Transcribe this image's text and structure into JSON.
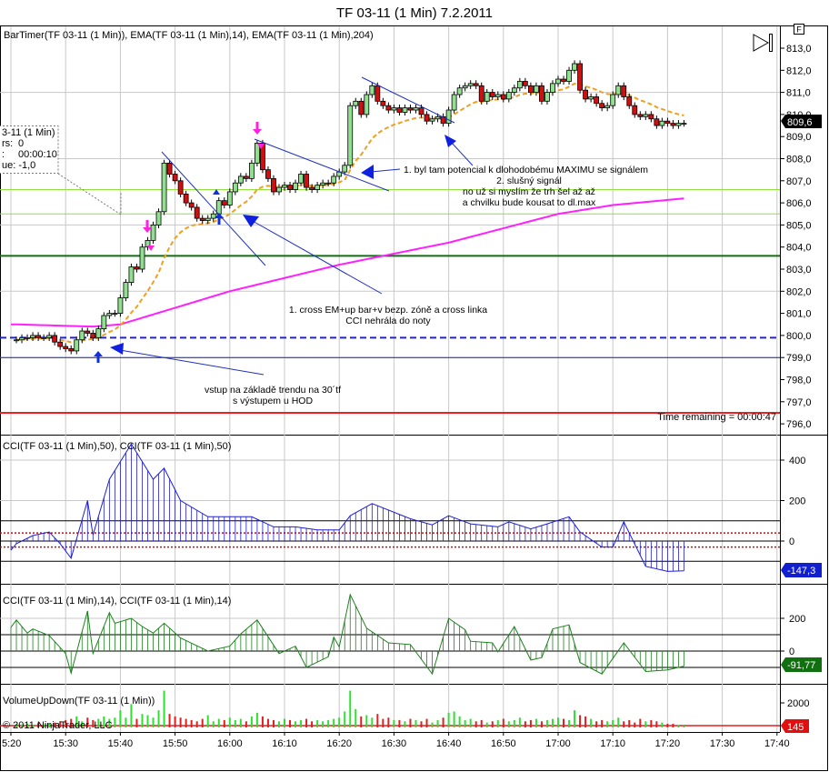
{
  "window": {
    "title": "TF 03-11 (1 Min)  7.2.2011",
    "f_button": "F"
  },
  "price_panel": {
    "legend": "BarTimer(TF 03-11 (1 Min)), EMA(TF 03-11 (1 Min),14), EMA(TF 03-11 (1 Min),204)",
    "axis_ticks": [
      "813,0",
      "812,0",
      "811,0",
      "810,0",
      "809,0",
      "808,0",
      "807,0",
      "806,0",
      "805,0",
      "804,0",
      "803,0",
      "802,0",
      "801,0",
      "800,0",
      "799,0",
      "798,0",
      "797,0",
      "796,0"
    ],
    "last_price_label": "809,6",
    "time_remaining": "Time remaining = 00:00:47",
    "data_box": {
      "line1": "3-11 (1 Min)",
      "line2_label": "rs:",
      "line2_value": "0",
      "line3_label": ":",
      "line3_value": "00:00:10",
      "line4": "ue: -1,0"
    },
    "annotations": {
      "note_max_1": "1. byl tam potencial k dlohodobému MAXIMU se signálem",
      "note_max_2": "2. slušný signál",
      "note_max_3": "no už si myslím že trh šel až až",
      "note_max_4": "a chvilku bude kousat to dl.max",
      "note_cross_1": "1. cross EM+up bar+v bezp. zóně a cross linka",
      "note_cross_2": "CCI nehrála do noty",
      "note_entry_1": "vstup na základě trendu na 30´tf",
      "note_entry_2": "s výstupem u HOD"
    }
  },
  "cci50_panel": {
    "legend": "CCI(TF 03-11 (1 Min),50), CCI(TF 03-11 (1 Min),50)",
    "ticks": [
      "400",
      "200",
      "0"
    ],
    "last_value": "-147,3"
  },
  "cci14_panel": {
    "legend": "CCI(TF 03-11 (1 Min),14), CCI(TF 03-11 (1 Min),14)",
    "ticks": [
      "200",
      "0"
    ],
    "last_value": "-91,77"
  },
  "volume_panel": {
    "legend": "VolumeUpDown(TF 03-11 (1 Min))",
    "ticks": [
      "2000"
    ],
    "last_value": "145"
  },
  "copyright": "© 2011 NinjaTrader, LLC",
  "time_axis": [
    "5:20",
    "15:30",
    "15:40",
    "15:50",
    "16:00",
    "16:10",
    "16:20",
    "16:30",
    "16:40",
    "16:50",
    "17:00",
    "17:10",
    "17:20",
    "17:30",
    "17:40"
  ],
  "colors": {
    "up": "#90e090",
    "down": "#d01010",
    "ema14": "#f0a020",
    "ema204": "#ff20ff",
    "cci50": "#2020d0",
    "cci14": "#208020",
    "vol_up": "#30e030",
    "vol_down": "#e02020"
  },
  "chart_data": [
    {
      "type": "candlestick",
      "title": "TF 03-11 (1 Min)",
      "x_unit": "minutes after 15:20",
      "first_bar_minute": 1,
      "ylim": [
        796,
        813
      ],
      "first_open": 799.8,
      "close": [
        799.8,
        799.9,
        799.9,
        800.0,
        799.9,
        799.9,
        800.0,
        799.7,
        799.5,
        799.4,
        799.3,
        799.8,
        800.2,
        800.1,
        799.9,
        800.3,
        800.9,
        801.0,
        801.0,
        801.7,
        802.4,
        803.1,
        803.0,
        804.0,
        804.3,
        805.0,
        805.6,
        807.8,
        807.3,
        807.0,
        806.4,
        806.0,
        805.8,
        805.3,
        805.2,
        805.3,
        805.5,
        806.1,
        805.9,
        806.5,
        806.9,
        807.2,
        807.1,
        807.8,
        808.7,
        807.5,
        807.1,
        806.5,
        806.7,
        806.8,
        806.6,
        806.9,
        807.3,
        806.7,
        806.6,
        806.8,
        806.9,
        806.9,
        807.2,
        807.4,
        807.7,
        810.4,
        810.6,
        810.0,
        810.9,
        811.3,
        810.6,
        810.4,
        810.2,
        810.3,
        810.1,
        810.3,
        810.2,
        810.3,
        810.0,
        809.7,
        809.8,
        809.9,
        809.6,
        810.2,
        810.9,
        811.2,
        811.3,
        811.4,
        811.3,
        810.6,
        811.0,
        810.8,
        810.9,
        810.7,
        811.0,
        811.2,
        811.5,
        811.3,
        811.0,
        811.3,
        810.6,
        811.0,
        811.4,
        811.6,
        811.5,
        812.0,
        812.3,
        811.1,
        810.7,
        810.8,
        810.5,
        810.3,
        810.4,
        810.9,
        811.3,
        810.8,
        810.4,
        810.0,
        809.9,
        810.0,
        809.8,
        809.5,
        809.7,
        809.6,
        809.5,
        809.6,
        809.6
      ],
      "ema14_period": 14,
      "ema204_points": [
        [
          1,
          800.5
        ],
        [
          15,
          800.4
        ],
        [
          20,
          800.5
        ],
        [
          40,
          802.0
        ],
        [
          60,
          803.2
        ],
        [
          80,
          804.2
        ],
        [
          100,
          805.5
        ],
        [
          110,
          805.9
        ],
        [
          123,
          806.2
        ]
      ],
      "horizontal_lines": [
        {
          "price": 806.6,
          "color": "#90e040",
          "style": "solid"
        },
        {
          "price": 805.5,
          "color": "#90e040",
          "style": "solid"
        },
        {
          "price": 803.6,
          "color": "#107010",
          "style": "solid"
        },
        {
          "price": 799.9,
          "color": "#2020e0",
          "style": "dashed"
        },
        {
          "price": 799.0,
          "color": "#2020a0",
          "style": "solid"
        },
        {
          "price": 796.5,
          "color": "#f02020",
          "style": "solid"
        }
      ]
    },
    {
      "type": "line",
      "title": "CCI 50",
      "x_unit": "minutes after 15:20",
      "ylim": [
        -200,
        480
      ],
      "levels": [
        100,
        -100
      ],
      "dotted_levels": [
        40,
        -30
      ],
      "points": [
        [
          0,
          -45
        ],
        [
          1,
          -13
        ],
        [
          4,
          27
        ],
        [
          7,
          45
        ],
        [
          9,
          -13
        ],
        [
          11,
          -85
        ],
        [
          14,
          200
        ],
        [
          15,
          30
        ],
        [
          18,
          305
        ],
        [
          22,
          480
        ],
        [
          26,
          305
        ],
        [
          28,
          360
        ],
        [
          31,
          200
        ],
        [
          36,
          120
        ],
        [
          44,
          120
        ],
        [
          48,
          70
        ],
        [
          52,
          70
        ],
        [
          56,
          55
        ],
        [
          60,
          55
        ],
        [
          62,
          125
        ],
        [
          66,
          185
        ],
        [
          73,
          110
        ],
        [
          77,
          80
        ],
        [
          80,
          125
        ],
        [
          84,
          85
        ],
        [
          89,
          70
        ],
        [
          91,
          95
        ],
        [
          95,
          60
        ],
        [
          98,
          85
        ],
        [
          102,
          120
        ],
        [
          104,
          45
        ],
        [
          108,
          -30
        ],
        [
          110,
          -30
        ],
        [
          112,
          95
        ],
        [
          116,
          -125
        ],
        [
          120,
          -150
        ],
        [
          123,
          -147
        ]
      ]
    },
    {
      "type": "line",
      "title": "CCI 14",
      "x_unit": "minutes after 15:20",
      "levels": [
        100,
        -100
      ],
      "points": [
        [
          0,
          145
        ],
        [
          1,
          190
        ],
        [
          3,
          110
        ],
        [
          4,
          135
        ],
        [
          7,
          95
        ],
        [
          10,
          -15
        ],
        [
          11,
          -135
        ],
        [
          14,
          245
        ],
        [
          15,
          -15
        ],
        [
          18,
          235
        ],
        [
          19,
          170
        ],
        [
          22,
          200
        ],
        [
          24,
          150
        ],
        [
          26,
          110
        ],
        [
          28,
          170
        ],
        [
          31,
          80
        ],
        [
          36,
          0
        ],
        [
          40,
          30
        ],
        [
          42,
          105
        ],
        [
          45,
          190
        ],
        [
          49,
          -15
        ],
        [
          52,
          30
        ],
        [
          54,
          -100
        ],
        [
          58,
          -35
        ],
        [
          59,
          85
        ],
        [
          60,
          25
        ],
        [
          62,
          345
        ],
        [
          65,
          140
        ],
        [
          69,
          50
        ],
        [
          73,
          40
        ],
        [
          77,
          -140
        ],
        [
          80,
          200
        ],
        [
          83,
          130
        ],
        [
          84,
          60
        ],
        [
          88,
          50
        ],
        [
          89,
          -5
        ],
        [
          92,
          150
        ],
        [
          95,
          -55
        ],
        [
          97,
          -40
        ],
        [
          99,
          135
        ],
        [
          102,
          160
        ],
        [
          104,
          -70
        ],
        [
          108,
          -140
        ],
        [
          112,
          50
        ],
        [
          116,
          -125
        ],
        [
          120,
          -115
        ],
        [
          123,
          -92
        ]
      ]
    },
    {
      "type": "bar",
      "title": "VolumeUpDown",
      "x_unit": "minutes after 15:20",
      "first_bar_minute": 1,
      "values": [
        300,
        250,
        300,
        200,
        350,
        250,
        300,
        400,
        500,
        600,
        700,
        900,
        500,
        800,
        600,
        700,
        900,
        700,
        800,
        1400,
        800,
        1900,
        700,
        1100,
        1000,
        800,
        1400,
        3000,
        1100,
        900,
        800,
        700,
        600,
        500,
        700,
        1000,
        500,
        700,
        600,
        800,
        600,
        700,
        500,
        900,
        1200,
        900,
        700,
        600,
        500,
        700,
        600,
        500,
        600,
        700,
        500,
        600,
        500,
        600,
        700,
        800,
        1300,
        3000,
        1500,
        900,
        1000,
        800,
        1100,
        700,
        800,
        600,
        600,
        500,
        700,
        600,
        500,
        700,
        400,
        600,
        800,
        1200,
        1300,
        900,
        600,
        700,
        500,
        600,
        400,
        500,
        600,
        700,
        500,
        600,
        800,
        500,
        600,
        700,
        500,
        600,
        700,
        800,
        700,
        600,
        1400,
        1000,
        900,
        700,
        500,
        600,
        500,
        600,
        800,
        500,
        600,
        400,
        700,
        500,
        600,
        500,
        400,
        300,
        300,
        200,
        145
      ]
    }
  ]
}
